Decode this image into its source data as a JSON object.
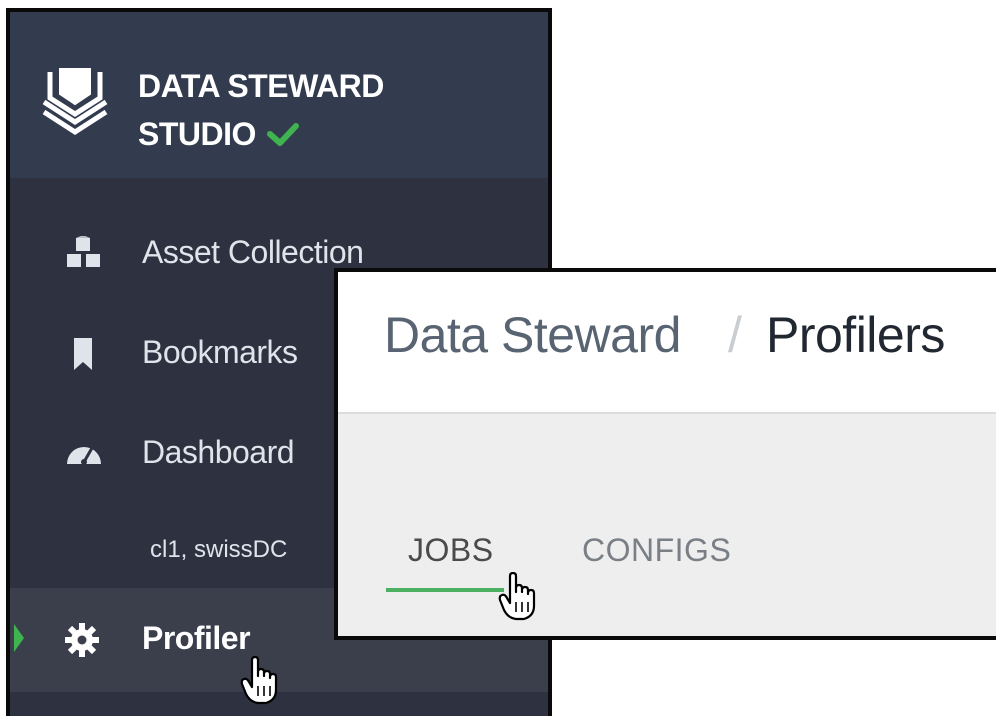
{
  "sidebar": {
    "brand": {
      "line1": "DATA STEWARD",
      "line2": "STUDIO",
      "logo_icon": "shield-stack-icon",
      "status_icon": "check-icon",
      "status_color": "#3fb34f"
    },
    "items": [
      {
        "label": "Asset Collection",
        "icon": "cubes-icon"
      },
      {
        "label": "Bookmarks",
        "icon": "bookmark-icon"
      },
      {
        "label": "Dashboard",
        "icon": "dashboard-icon"
      },
      {
        "label": "cl1, swissDC",
        "icon": null
      },
      {
        "label": "Profiler",
        "icon": "gear-icon",
        "active": true
      }
    ],
    "colors": {
      "background": "#2d3140",
      "brand_background": "#333b4f",
      "active_background": "#3b3f4c",
      "active_marker": "#3fb34f"
    }
  },
  "panel": {
    "breadcrumb": {
      "root": "Data Steward",
      "separator": "/",
      "current": "Profilers"
    },
    "tabs": [
      {
        "label": "JOBS",
        "active": true
      },
      {
        "label": "CONFIGS",
        "active": false
      }
    ],
    "colors": {
      "tab_underline": "#4cb063",
      "body_background": "#eeeeee"
    }
  },
  "cursors": [
    "hand-pointer-icon",
    "hand-pointer-icon"
  ]
}
